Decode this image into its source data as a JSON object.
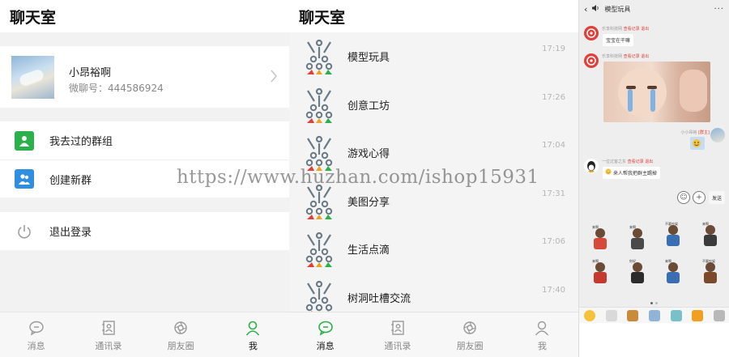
{
  "me_screen": {
    "title": "聊天室",
    "profile": {
      "name": "小昂裕啊",
      "id_text": "微聊号：444586924"
    },
    "menu": [
      {
        "label": "我去过的群组",
        "icon": "person-icon",
        "color": "#2bb04a"
      },
      {
        "label": "创建新群",
        "icon": "people-icon",
        "color": "#2f8ee0"
      },
      {
        "label": "退出登录",
        "icon": "power-icon",
        "color": "#999999"
      }
    ],
    "tabs": [
      {
        "label": "消息",
        "icon": "chat-bubble-icon",
        "active": false
      },
      {
        "label": "通讯录",
        "icon": "contacts-icon",
        "active": false
      },
      {
        "label": "朋友圈",
        "icon": "moments-icon",
        "active": false
      },
      {
        "label": "我",
        "icon": "profile-icon",
        "active": true
      }
    ]
  },
  "rooms_screen": {
    "title": "聊天室",
    "rooms": [
      {
        "name": "模型玩具",
        "time": "17:19"
      },
      {
        "name": "创意工坊",
        "time": "17:26"
      },
      {
        "name": "游戏心得",
        "time": "17:04"
      },
      {
        "name": "美图分享",
        "time": "17:31"
      },
      {
        "name": "生活点滴",
        "time": "17:06"
      },
      {
        "name": "树洞吐槽交流",
        "time": "17:40"
      }
    ],
    "tabs": [
      {
        "label": "消息",
        "icon": "chat-bubble-icon",
        "active": true
      },
      {
        "label": "通讯录",
        "icon": "contacts-icon",
        "active": false
      },
      {
        "label": "朋友圈",
        "icon": "moments-icon",
        "active": false
      },
      {
        "label": "我",
        "icon": "profile-icon",
        "active": false
      }
    ]
  },
  "chat_screen": {
    "title": "模型玩具",
    "back_glyph": "‹",
    "more_glyph": "···",
    "messages": [
      {
        "sender": "乐享科技网",
        "tag": "查看记录 退出",
        "text": "宝宝在干嘛"
      },
      {
        "sender": "乐享科技网",
        "tag": "查看记录 退出",
        "text": ""
      },
      {
        "sender": "小小昂裕",
        "tag": "[群主]",
        "text": ""
      },
      {
        "sender": "一位过客之东",
        "tag": "查看记录 退出",
        "text": "来人帮我把群主踢掉"
      }
    ],
    "input": {
      "emoji_glyph": "☺",
      "plus_glyph": "+",
      "send_label": "发送"
    },
    "sticker_captions": [
      "来啊",
      "来啊",
      "不要吵架",
      "来啊",
      "来啊",
      "你好",
      "来啊",
      "不要吵架"
    ]
  },
  "watermark": "https://www.huzhan.com/ishop15931",
  "colors": {
    "accent_green": "#2bb04a",
    "accent_blue": "#2f8ee0",
    "tag_red": "#e0403a"
  }
}
